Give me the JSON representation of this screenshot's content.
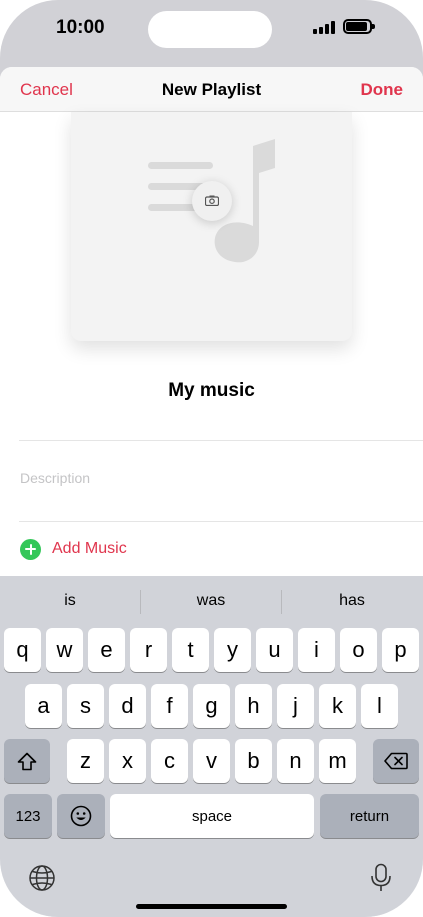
{
  "status_bar": {
    "time": "10:00"
  },
  "nav": {
    "cancel_label": "Cancel",
    "title": "New Playlist",
    "done_label": "Done"
  },
  "playlist": {
    "name": "My music",
    "description_placeholder": "Description",
    "add_music_label": "Add Music"
  },
  "keyboard": {
    "suggestions": [
      "is",
      "was",
      "has"
    ],
    "row1": [
      "q",
      "w",
      "e",
      "r",
      "t",
      "y",
      "u",
      "i",
      "o",
      "p"
    ],
    "row2": [
      "a",
      "s",
      "d",
      "f",
      "g",
      "h",
      "j",
      "k",
      "l"
    ],
    "row3": [
      "z",
      "x",
      "c",
      "v",
      "b",
      "n",
      "m"
    ],
    "numbers_label": "123",
    "space_label": "space",
    "return_label": "return"
  },
  "colors": {
    "accent": "#e0354d",
    "add_icon": "#34c759",
    "keyboard_bg": "#d1d3d9"
  },
  "icons": [
    "camera-icon",
    "music-note-icon",
    "shift-icon",
    "delete-icon",
    "emoji-icon",
    "globe-icon",
    "microphone-icon",
    "plus-circle-icon"
  ]
}
